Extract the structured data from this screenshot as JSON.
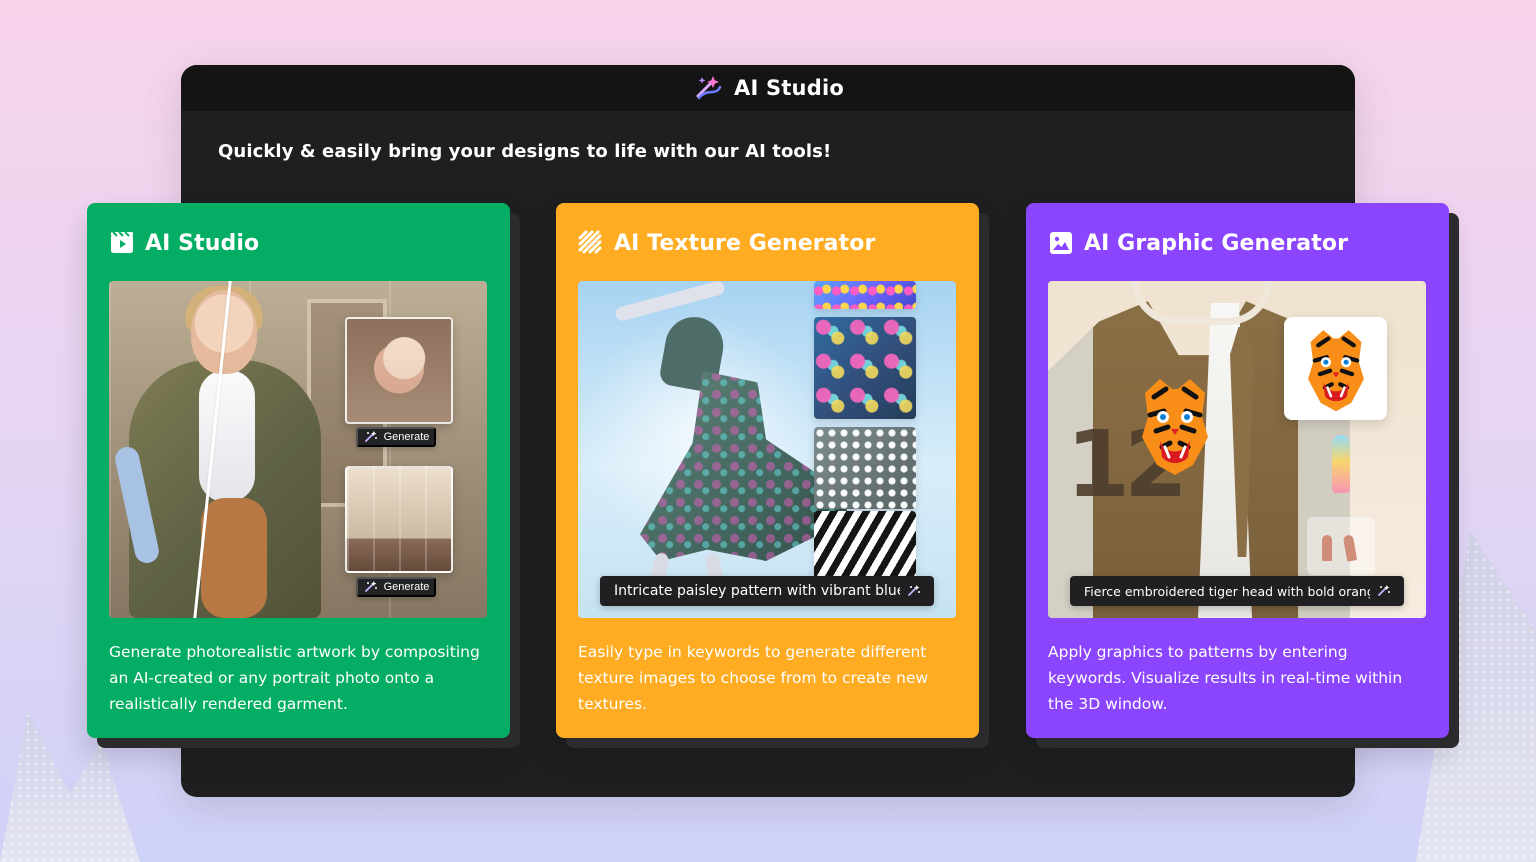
{
  "header": {
    "title": "AI Studio",
    "subtitle": "Quickly & easily bring your designs to life with our AI tools!"
  },
  "cards": [
    {
      "title": "AI Studio",
      "description": "Generate photorealistic artwork by compositing an AI-created or any portrait photo onto a realistically rendered garment.",
      "buttons": [
        "Generate",
        "Generate"
      ],
      "icon": "film-icon",
      "color": "#03ae64"
    },
    {
      "title": "AI Texture Generator",
      "description": "Easily type in keywords to generate different texture images to choose from to create new textures.",
      "prompt": "Intricate paisley pattern with vibrant blue",
      "icon": "texture-lines-icon",
      "color": "#ffac22"
    },
    {
      "title": "AI Graphic Generator",
      "description": "Apply graphics to patterns by entering keywords. Visualize results in real-time within the 3D window.",
      "prompt": "Fierce embroidered tiger head with bold orange",
      "icon": "image-icon",
      "color": "#8b45ff"
    }
  ]
}
